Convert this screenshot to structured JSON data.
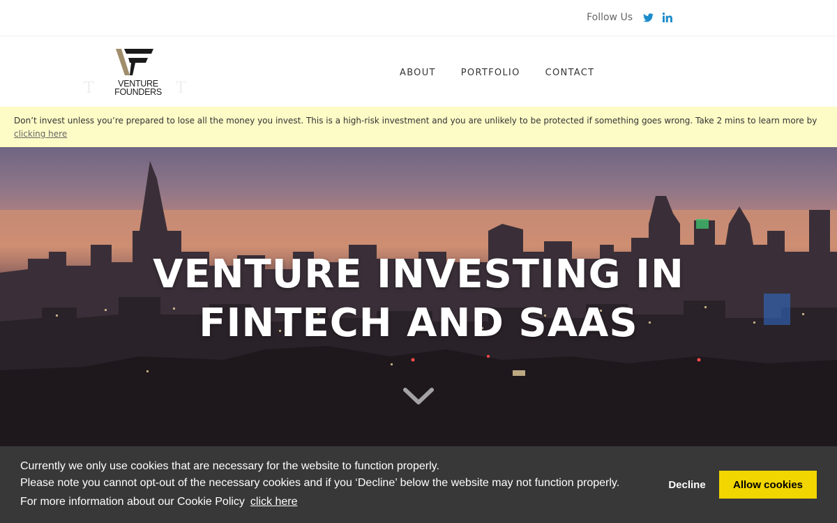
{
  "topbar": {
    "follow_label": "Follow Us",
    "social_icons": [
      "twitter-icon",
      "linkedin-icon"
    ],
    "social_color": "#1d8ccb"
  },
  "header": {
    "logo": {
      "line1": "VENTURE",
      "line2": "FOUNDERS"
    },
    "nav": [
      {
        "label": "ABOUT"
      },
      {
        "label": "PORTFOLIO"
      },
      {
        "label": "CONTACT"
      }
    ]
  },
  "warning": {
    "text": "Don’t invest unless you’re prepared to lose all the money you invest. This is a high-risk investment and you are unlikely to be protected if something goes wrong. Take 2 mins to learn more by",
    "link_label": "clicking here",
    "background": "#fdfbc6"
  },
  "hero": {
    "title_line1": "VENTURE INVESTING IN",
    "title_line2": "FINTECH AND SAAS",
    "scroll_icon": "chevron-down-icon"
  },
  "cookie": {
    "line1": "Currently we only use cookies that are necessary for the website to function properly.",
    "line2": "Please note you cannot opt-out of the necessary cookies and if you ‘Decline’ below the website may not function properly.",
    "line3": "For more information about our Cookie Policy",
    "link_label": "click here",
    "decline_label": "Decline",
    "allow_label": "Allow cookies",
    "accent": "#f1d600",
    "background": "#383838"
  }
}
